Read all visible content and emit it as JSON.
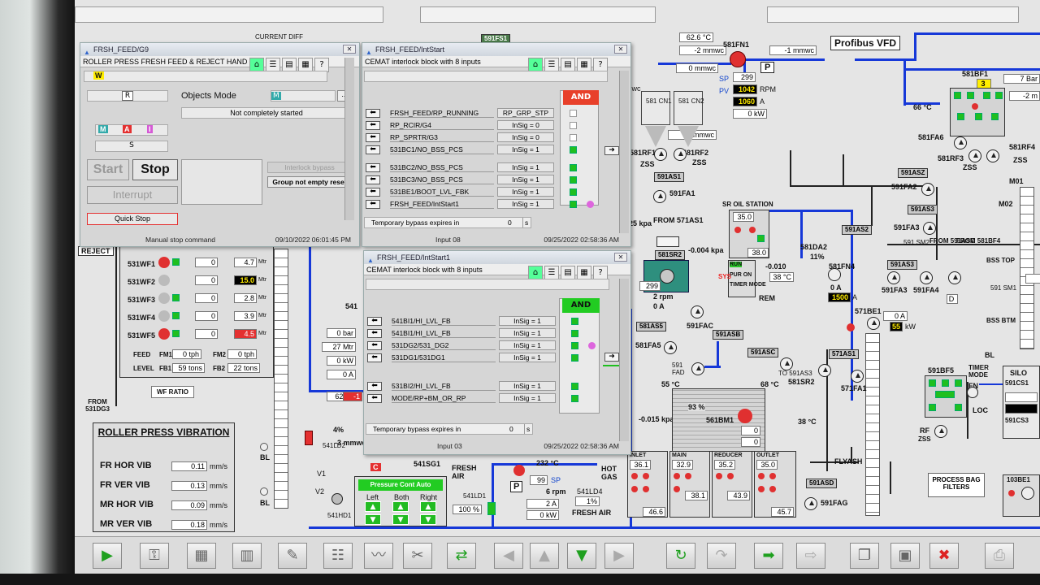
{
  "top": {
    "current_diff": "CURRENT DIFF",
    "tag_591": "591FS1"
  },
  "vfd": {
    "title": "Profibus VFD",
    "temp": "62.6 °C",
    "pressure": "-2 mmwc",
    "fan": "581FN1",
    "pressure2": "-1 mmwc",
    "sp_label": "SP",
    "sp": "299",
    "pv_label": "PV",
    "rpm": "1042",
    "rpm_unit": "RPM",
    "amps": "1060",
    "amps_unit": "A",
    "kw": "0 kW",
    "p_label": "P",
    "mmwc1": "0 mmwc",
    "mmwc2": "0 mmwc"
  },
  "cyclones": {
    "cn1": "581 CN1",
    "cn2": "581 CN2",
    "rf1": "581RF1",
    "rf2": "581RF2",
    "zss": "ZSS",
    "as1": "591AS1",
    "fa1": "591FA1",
    "mwc": "mwc"
  },
  "bag": {
    "bf1": "581BF1",
    "bar": "7 Bar",
    "val3": "3",
    "temp": "66 °C",
    "m2": "-2 m",
    "rf3": "581RF3",
    "rf4": "581RF4",
    "fa6": "581FA6",
    "fa6b": "581FA6",
    "zss": "ZSS",
    "asz": "591ASZ",
    "fa2": "591FA2",
    "as3": "591AS3",
    "fa3": "591FA3",
    "fa4": "591FA4",
    "bss": "BSS TOP",
    "sm1": "591 SM1",
    "sm2": "591 SM2",
    "from_asc": "FROM 591ASC",
    "from_bf4": "FROM 581BF4",
    "m01": "M01",
    "m02": "M02",
    "bss_btm": "BSS BTM",
    "bl": "BL",
    "d": "D"
  },
  "mill": {
    "kpa": "25 kpa",
    "from_as1": "FROM 571AS1",
    "sr2": "581SR2",
    "rpm_299": "299",
    "rpm2": "2 rpm",
    "a0": "0 A",
    "p004": "-0.004 kpa",
    "oil": "SR OIL STATION",
    "t35": "35.0",
    "t38": "38.0",
    "run": "RUN",
    "pur": "PUR ON",
    "timer": "TIMER MODE",
    "rem": "REM",
    "fac": "591FAC",
    "asb": "591ASB",
    "asc": "591ASC",
    "as5": "581AS5",
    "fa5": "581FA5",
    "fad": "591 FAD",
    "to": "TO 591AS3",
    "p010": "-0.010",
    "t38b": "38 °C",
    "da2": "581DA2",
    "pct11": "11%",
    "fn4": "581FN4",
    "a0b": "0 A",
    "a1500": "1500",
    "a_unit": "A",
    "as2": "591AS2",
    "sys": "SYS"
  },
  "be": {
    "be1": "571BE1",
    "a0": "0 A",
    "kw55": "55",
    "kw": "kW",
    "as1": "571AS1",
    "sr2": "581SR2",
    "fa1": "571FA1",
    "bl": "BL"
  },
  "filter": {
    "t55": "55 °C",
    "kpa": "-0.015 kpa",
    "pct93": "93 %",
    "bm1": "561BM1",
    "t68": "68 °C",
    "t38": "38 °C",
    "inlet": "INLET",
    "main": "MAIN",
    "reducer": "REDUCER",
    "outlet": "OUTLET",
    "t361": "36.1",
    "t329": "32.9",
    "t352": "35.2",
    "t350": "35.0",
    "t466": "46.6",
    "t381": "38.1",
    "t439": "43.9",
    "t457": "45.7",
    "flyash": "FLYASH",
    "asd": "591ASD",
    "fag": "591FAG",
    "zero1": "0",
    "zero2": "0"
  },
  "silo": {
    "bf5": "591BF5",
    "timer": "TIMER MODE",
    "fn": "FN",
    "loc": "LOC",
    "rf": "RF",
    "zss": "ZSS",
    "silo": "SILO",
    "cs1": "591CS1",
    "cs3": "591CS3",
    "process": "PROCESS BAG FILTERS",
    "be1": "103BE1"
  },
  "hotgas": {
    "t232": "232 °C",
    "p": "P",
    "sp": "99",
    "sp_label": "SP",
    "rpm": "6 rpm",
    "a2": "2 A",
    "kw": "0 kW",
    "hot": "HOT GAS",
    "ld4": "541LD4",
    "pct1": "1%",
    "fresh": "FRESH AIR",
    "fresh_air": "FRESH AIR",
    "ld1": "541LD1",
    "pct100": "100 %",
    "sg1": "541SG1",
    "c": "C",
    "ld2": "541LD2",
    "mmwc": "-3 mmwc",
    "pct4": "4%",
    "v1": "V1",
    "v2": "V2",
    "hd1": "541HD1",
    "pca": "Pressure Cont Auto",
    "left": "Left",
    "both": "Both",
    "right": "Right"
  },
  "weigh": {
    "reject": "REJECT",
    "wf1": "531WF1",
    "wf2": "531WF2",
    "wf3": "531WF3",
    "wf4": "531WF4",
    "wf5": "531WF5",
    "v1": "4.7",
    "v2": "15.0",
    "v3": "2.8",
    "v4": "3.9",
    "v5": "4.5",
    "unit": "Mtr",
    "zero": "0",
    "feed": "FEED",
    "fm1": "FM1",
    "fm1v": "0 tph",
    "fm2": "FM2",
    "fm2v": "0 tph",
    "level": "LEVEL",
    "fb1": "FB1",
    "fb1v": "59 tons",
    "fb2": "FB2",
    "fb2v": "22 tons",
    "wf_ratio": "WF RATIO",
    "from": "FROM 531DG3"
  },
  "vib": {
    "title": "ROLLER PRESS VIBRATION",
    "r1": "FR HOR VIB",
    "v1": "0.11",
    "r2": "FR VER VIB",
    "v2": "0.13",
    "r3": "MR HOR VIB",
    "v3": "0.09",
    "r4": "MR VER VIB",
    "v4": "0.18",
    "unit": "mm/s",
    "bl": "BL"
  },
  "mid": {
    "l541": "541",
    "bar0": "0 bar",
    "m27": "27 Mtr",
    "kw0": "0 kW",
    "a0": "0 A",
    "a0b": "0 A",
    "t62": "62 °C",
    "red": "-1"
  },
  "win1": {
    "title": "FRSH_FEED/G9",
    "header": "ROLLER PRESS FRESH FEED & REJECT HAND",
    "w": "W",
    "r": "R",
    "objects_mode": "Objects Mode",
    "m": "M",
    "status": "Not completely started",
    "s": "S",
    "a": "A",
    "i": "I",
    "start": "Start",
    "stop": "Stop",
    "interlock_bypass": "Interlock bypass",
    "group_not_empty": "Group not empty reset",
    "interrupt": "Interrupt",
    "quick_stop": "Quick Stop",
    "status_left": "Manual stop command",
    "status_right": "09/10/2022 06:01:45 PM"
  },
  "win2": {
    "title": "FRSH_FEED/IntStart",
    "header": "CEMAT interlock block with 8 inputs",
    "gate": "AND",
    "rows": [
      {
        "label": "FRSH_FEED/RP_RUNNING",
        "sig": "RP_GRP_STP"
      },
      {
        "label": "RP_RCIR/G4",
        "sig": "InSig = 0"
      },
      {
        "label": "RP_SPRTR/G3",
        "sig": "InSig = 0"
      },
      {
        "label": "531BC1/NO_BSS_PCS",
        "sig": "InSig = 1"
      },
      {
        "label": "531BC2/NO_BSS_PCS",
        "sig": "InSig = 1"
      },
      {
        "label": "531BC3/NO_BSS_PCS",
        "sig": "InSig = 1"
      },
      {
        "label": "531BE1/BOOT_LVL_FBK",
        "sig": "InSig = 1"
      },
      {
        "label": "FRSH_FEED/IntStart1",
        "sig": "InSig = 1"
      }
    ],
    "bypass": "Temporary bypass expires in",
    "bypass_val": "0",
    "bypass_unit": "s",
    "status_left": "Input 08",
    "status_right": "09/25/2022 02:58:36 AM"
  },
  "win3": {
    "title": "FRSH_FEED/IntStart1",
    "header": "CEMAT interlock block with 8 inputs",
    "gate": "AND",
    "rows": [
      {
        "label": "541BI1/HI_LVL_FB",
        "sig": "InSig = 1"
      },
      {
        "label": "541BI1/HI_LVL_FB",
        "sig": "InSig = 1"
      },
      {
        "label": "531DG2/531_DG2",
        "sig": "InSig = 1"
      },
      {
        "label": "531DG1/531DG1",
        "sig": "InSig = 1"
      },
      {
        "label": "531BI2/HI_LVL_FB",
        "sig": "InSig = 1"
      },
      {
        "label": "MODE/RP+BM_OR_RP",
        "sig": "InSig = 1"
      }
    ],
    "bypass": "Temporary bypass expires in",
    "bypass_val": "0",
    "bypass_unit": "s",
    "status_left": "Input 03",
    "status_right": "09/25/2022 02:58:36 AM"
  },
  "toolbar": [
    "play-icon",
    "key-icon",
    "folder-icon",
    "folder-c-icon",
    "wrench-icon",
    "report-icon",
    "trend-icon",
    "tool-icon",
    "swap-icon",
    "arrow-left-icon",
    "arrow-up-icon",
    "arrow-down-green-icon",
    "arrow-right-icon",
    "refresh-icon",
    "redo-icon",
    "forward-icon",
    "next-icon",
    "copy-icon",
    "save-icon",
    "delete-icon",
    "print-icon"
  ],
  "colors": {
    "pipe_blue": "#1638d8",
    "and_red": "#e8402a",
    "and_green": "#22cc22",
    "led_green": "#1fbf1f"
  }
}
